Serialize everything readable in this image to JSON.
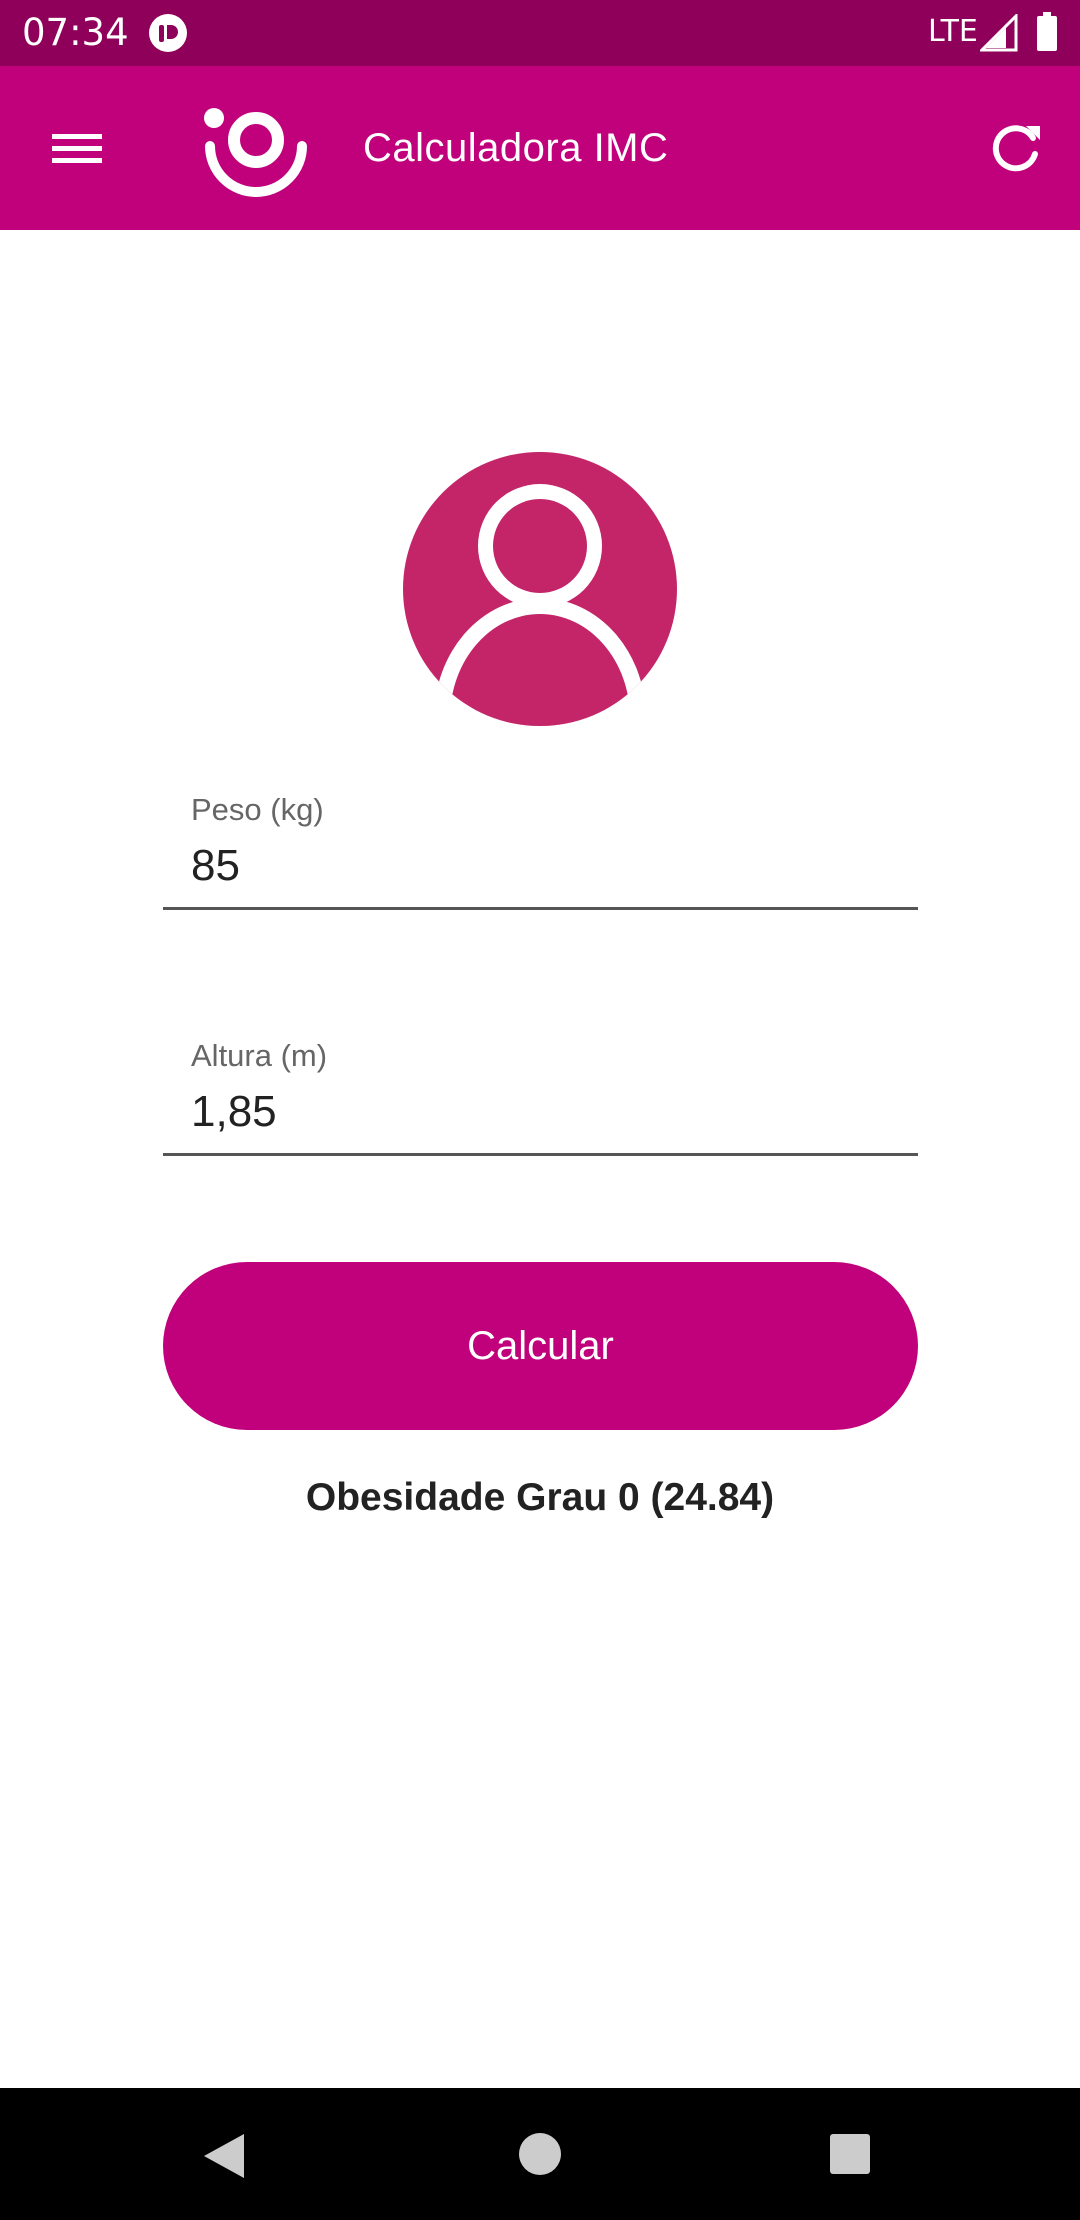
{
  "status_bar": {
    "time": "07:34",
    "network": "LTE",
    "icons": [
      "app-notification-icon",
      "signal-icon",
      "battery-icon"
    ]
  },
  "app_bar": {
    "title": "Calculadora IMC",
    "icons": [
      "menu-icon",
      "app-logo",
      "refresh-icon"
    ]
  },
  "avatar": {
    "icon": "user-avatar-icon"
  },
  "form": {
    "weight": {
      "label": "Peso (kg)",
      "value": "85"
    },
    "height": {
      "label": "Altura (m)",
      "value": "1,85"
    },
    "calculate_label": "Calcular"
  },
  "result": {
    "text": "Obesidade Grau 0 (24.84)"
  },
  "nav_bar": {
    "icons": [
      "back-icon",
      "home-icon",
      "recents-icon"
    ]
  },
  "colors": {
    "primary": "#c1007b",
    "status_bar": "#8e0059",
    "avatar": "#c42568",
    "text": "#222222",
    "label": "#666666"
  }
}
